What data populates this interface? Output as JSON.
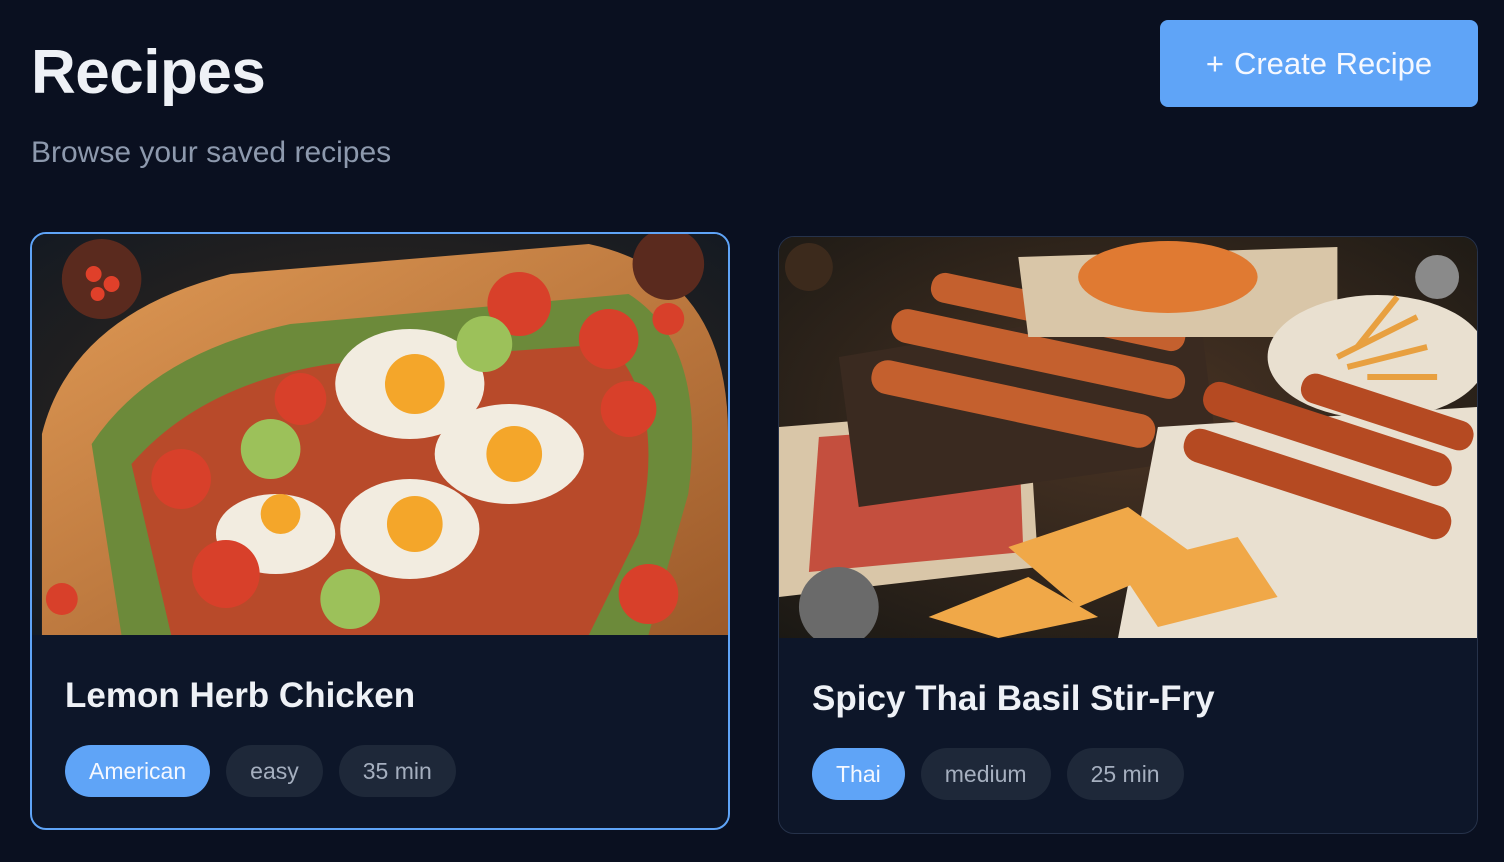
{
  "header": {
    "title": "Recipes",
    "subtitle": "Browse your saved recipes"
  },
  "actions": {
    "create_icon": "+",
    "create_label": "Create Recipe"
  },
  "colors": {
    "background": "#0a1020",
    "card": "#0d1629",
    "accent": "#5fa4f7",
    "tag_neutral": "#1e2839"
  },
  "recipes": [
    {
      "title": "Lemon Herb Chicken",
      "image": "food-illustration-bread-eggs-tomatoes",
      "cuisine": "American",
      "difficulty": "easy",
      "time": "35 min",
      "selected": true
    },
    {
      "title": "Spicy Thai Basil Stir-Fry",
      "image": "food-illustration-skewers-flatbread",
      "cuisine": "Thai",
      "difficulty": "medium",
      "time": "25 min",
      "selected": false
    }
  ]
}
